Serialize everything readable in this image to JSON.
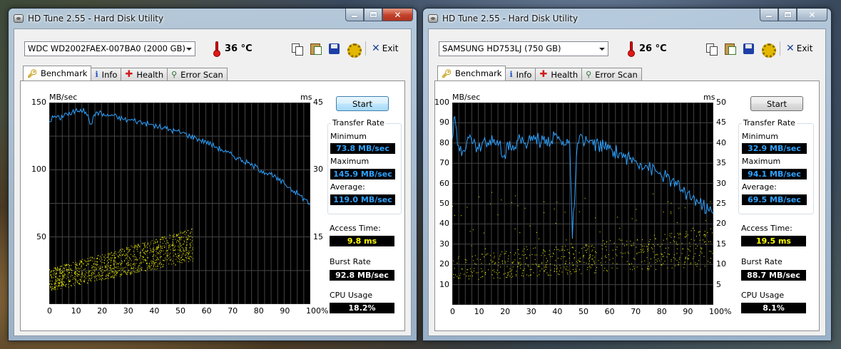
{
  "windows": [
    {
      "title": "HD Tune 2.55 - Hard Disk Utility",
      "drive": "WDC WD2002FAEX-007BA0 (2000 GB)",
      "temperature": "36 °C",
      "exit_label": "Exit",
      "tabs": [
        {
          "label": "Benchmark",
          "icon": "benchmark-icon",
          "active": true
        },
        {
          "label": "Info",
          "icon": "info-icon",
          "active": false
        },
        {
          "label": "Health",
          "icon": "health-icon",
          "active": false
        },
        {
          "label": "Error Scan",
          "icon": "error-scan-icon",
          "active": false
        }
      ],
      "start_label": "Start",
      "stats": {
        "transfer_rate_title": "Transfer Rate",
        "minimum_label": "Minimum",
        "minimum": "73.8 MB/sec",
        "maximum_label": "Maximum",
        "maximum": "145.9 MB/sec",
        "average_label": "Average:",
        "average": "119.0 MB/sec",
        "access_time_label": "Access Time:",
        "access_time": "9.8 ms",
        "burst_rate_label": "Burst Rate",
        "burst_rate": "92.8 MB/sec",
        "cpu_usage_label": "CPU Usage",
        "cpu_usage": "18.2%"
      },
      "chart_data": {
        "type": "line",
        "ylabel": "MB/sec",
        "y2label": "ms",
        "ylim": [
          0,
          150
        ],
        "y_ticks": [
          "150",
          "100",
          "50"
        ],
        "y_tick_values": [
          150,
          100,
          50
        ],
        "y2lim": [
          0,
          45
        ],
        "y2_ticks": [
          "45",
          "30",
          "15"
        ],
        "y2_tick_values": [
          45,
          30,
          15
        ],
        "xlim": [
          0,
          100
        ],
        "x_ticks": [
          "0",
          "10",
          "20",
          "30",
          "40",
          "50",
          "60",
          "70",
          "80",
          "90",
          "100%"
        ],
        "x_tick_values": [
          0,
          10,
          20,
          30,
          40,
          50,
          60,
          70,
          80,
          90,
          100
        ],
        "grid": true,
        "line_color": "#2ea2ff",
        "point_color": "#ffff00",
        "series": [
          {
            "kind": "transfer-rate",
            "x": [
              0,
              2,
              4,
              6,
              8,
              10,
              12,
              14,
              16,
              18,
              20,
              22,
              24,
              26,
              28,
              30,
              32,
              34,
              36,
              38,
              40,
              42,
              44,
              46,
              48,
              50,
              52,
              54,
              56,
              58,
              60,
              62,
              64,
              66,
              68,
              70,
              72,
              74,
              76,
              78,
              80,
              82,
              84,
              86,
              88,
              90,
              92,
              94,
              96,
              98,
              100
            ],
            "values": [
              136,
              140,
              138,
              142,
              141,
              144,
              145,
              143,
              134,
              143,
              142,
              140,
              141,
              139,
              138,
              137,
              137,
              136,
              135,
              134,
              133,
              132,
              131,
              130,
              129,
              128,
              127,
              125,
              124,
              122,
              121,
              119,
              117,
              115,
              113,
              111,
              109,
              107,
              105,
              103,
              101,
              99,
              97,
              95,
              92,
              90,
              87,
              84,
              81,
              78,
              74
            ]
          },
          {
            "kind": "access-time",
            "x_range": [
              0,
              55
            ],
            "ms_band_low": [
              3,
              8
            ],
            "ms_band_high": [
              14,
              17
            ],
            "count": 1100
          }
        ]
      }
    },
    {
      "title": "HD Tune 2.55 - Hard Disk Utility",
      "drive": "SAMSUNG HD753LJ (750 GB)",
      "temperature": "26 °C",
      "exit_label": "Exit",
      "tabs": [
        {
          "label": "Benchmark",
          "icon": "benchmark-icon",
          "active": true
        },
        {
          "label": "Info",
          "icon": "info-icon",
          "active": false
        },
        {
          "label": "Health",
          "icon": "health-icon",
          "active": false
        },
        {
          "label": "Error Scan",
          "icon": "error-scan-icon",
          "active": false
        }
      ],
      "start_label": "Start",
      "stats": {
        "transfer_rate_title": "Transfer Rate",
        "minimum_label": "Minimum",
        "minimum": "32.9 MB/sec",
        "maximum_label": "Maximum",
        "maximum": "94.1 MB/sec",
        "average_label": "Average:",
        "average": "69.5 MB/sec",
        "access_time_label": "Access Time:",
        "access_time": "19.5 ms",
        "burst_rate_label": "Burst Rate",
        "burst_rate": "88.7 MB/sec",
        "cpu_usage_label": "CPU Usage",
        "cpu_usage": "8.1%"
      },
      "chart_data": {
        "type": "line",
        "ylabel": "MB/sec",
        "y2label": "ms",
        "ylim": [
          0,
          100
        ],
        "y_ticks": [
          "100",
          "90",
          "80",
          "70",
          "60",
          "50",
          "40",
          "30",
          "20",
          "10"
        ],
        "y_tick_values": [
          100,
          90,
          80,
          70,
          60,
          50,
          40,
          30,
          20,
          10
        ],
        "y2lim": [
          0,
          50
        ],
        "y2_ticks": [
          "50",
          "45",
          "40",
          "35",
          "30",
          "25",
          "20",
          "15",
          "10",
          "5"
        ],
        "y2_tick_values": [
          50,
          45,
          40,
          35,
          30,
          25,
          20,
          15,
          10,
          5
        ],
        "xlim": [
          0,
          100
        ],
        "x_ticks": [
          "0",
          "10",
          "20",
          "30",
          "40",
          "50",
          "60",
          "70",
          "80",
          "90",
          "100%"
        ],
        "x_tick_values": [
          0,
          10,
          20,
          30,
          40,
          50,
          60,
          70,
          80,
          90,
          100
        ],
        "grid": true,
        "line_color": "#2ea2ff",
        "point_color": "#ffff00",
        "series": [
          {
            "kind": "transfer-rate",
            "x": [
              0,
              1,
              2,
              4,
              6,
              8,
              10,
              12,
              14,
              16,
              18,
              20,
              22,
              24,
              26,
              28,
              30,
              32,
              34,
              36,
              38,
              40,
              42,
              44,
              45,
              46,
              48,
              50,
              52,
              54,
              56,
              58,
              60,
              62,
              64,
              66,
              68,
              70,
              72,
              74,
              76,
              78,
              80,
              82,
              84,
              86,
              88,
              90,
              92,
              94,
              96,
              98,
              100
            ],
            "values": [
              82,
              93,
              79,
              76,
              83,
              80,
              77,
              81,
              79,
              82,
              80,
              74,
              81,
              78,
              82,
              80,
              81,
              83,
              80,
              82,
              81,
              84,
              79,
              82,
              80,
              33,
              80,
              82,
              81,
              79,
              79,
              78,
              77,
              76,
              75,
              73,
              72,
              71,
              70,
              69,
              67,
              66,
              64,
              63,
              61,
              59,
              57,
              55,
              53,
              51,
              49,
              47,
              45
            ]
          },
          {
            "kind": "access-time",
            "x_range": [
              0,
              100
            ],
            "ms_band_low": [
              6,
              12
            ],
            "ms_band_high": [
              12,
              19
            ],
            "count": 650
          }
        ]
      }
    }
  ]
}
